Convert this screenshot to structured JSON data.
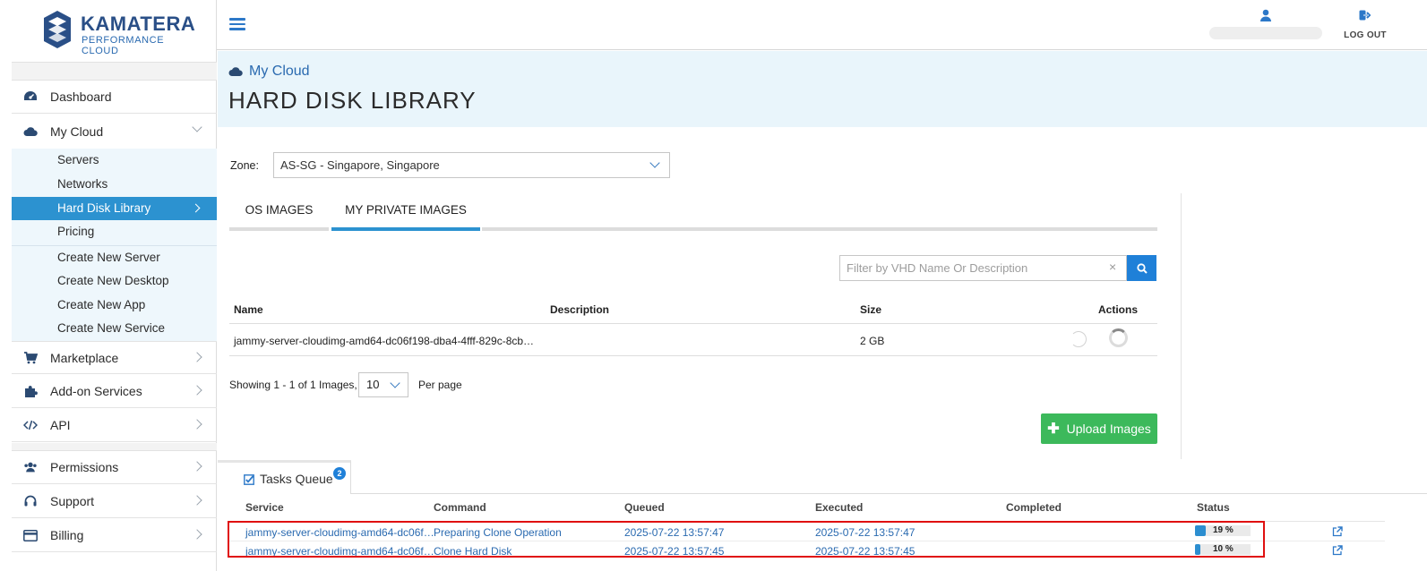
{
  "brand": {
    "name": "KAMATERA",
    "tagline": "PERFORMANCE CLOUD"
  },
  "sidebar": {
    "items": [
      {
        "label": "Dashboard",
        "icon": "dashboard-icon"
      },
      {
        "label": "My Cloud",
        "icon": "cloud-icon",
        "expanded": true
      },
      {
        "label": "Marketplace",
        "icon": "cart-icon"
      },
      {
        "label": "Add-on Services",
        "icon": "puzzle-icon"
      },
      {
        "label": "API",
        "icon": "code-icon"
      },
      {
        "label": "Permissions",
        "icon": "users-icon"
      },
      {
        "label": "Support",
        "icon": "headset-icon"
      },
      {
        "label": "Billing",
        "icon": "card-icon"
      }
    ],
    "my_cloud_sub": [
      "Servers",
      "Networks",
      "Hard Disk Library",
      "Pricing"
    ],
    "create_sub": [
      "Create New Server",
      "Create New Desktop",
      "Create New App",
      "Create New Service"
    ]
  },
  "header": {
    "logout_label": "LOG OUT"
  },
  "page": {
    "breadcrumb": "My Cloud",
    "title": "HARD DISK LIBRARY"
  },
  "zone": {
    "label": "Zone:",
    "value": "AS-SG - Singapore, Singapore"
  },
  "tabs": [
    "OS IMAGES",
    "MY PRIVATE IMAGES"
  ],
  "filter": {
    "placeholder": "Filter by VHD Name Or Description",
    "clear": "×"
  },
  "table": {
    "headers": {
      "name": "Name",
      "description": "Description",
      "size": "Size",
      "actions": "Actions"
    },
    "rows": [
      {
        "name": "jammy-server-cloudimg-amd64-dc06f198-dba4-4fff-829c-8cb…",
        "description": "",
        "size": "2 GB"
      }
    ]
  },
  "pager": {
    "showing": "Showing 1 - 1 of 1 Images,",
    "per_page_value": "10",
    "per_page_label": "Per page"
  },
  "upload": {
    "label": "Upload Images"
  },
  "tasks": {
    "tab_label": "Tasks Queue",
    "badge": "2",
    "headers": {
      "service": "Service",
      "command": "Command",
      "queued": "Queued",
      "executed": "Executed",
      "completed": "Completed",
      "status": "Status"
    },
    "rows": [
      {
        "service": "jammy-server-cloudimg-amd64-dc06f…",
        "command": "Preparing Clone Operation",
        "queued": "2025-07-22 13:57:47",
        "executed": "2025-07-22 13:57:47",
        "completed": "",
        "status_label": "19 %",
        "progress": 0.19
      },
      {
        "service": "jammy-server-cloudimg-amd64-dc06f…",
        "command": "Clone Hard Disk",
        "queued": "2025-07-22 13:57:45",
        "executed": "2025-07-22 13:57:45",
        "completed": "",
        "status_label": "10 %",
        "progress": 0.1
      }
    ]
  },
  "colors": {
    "accent": "#2c92d0",
    "brand": "#2a4f87",
    "upload": "#3cb95b",
    "highlight": "#e01010"
  }
}
